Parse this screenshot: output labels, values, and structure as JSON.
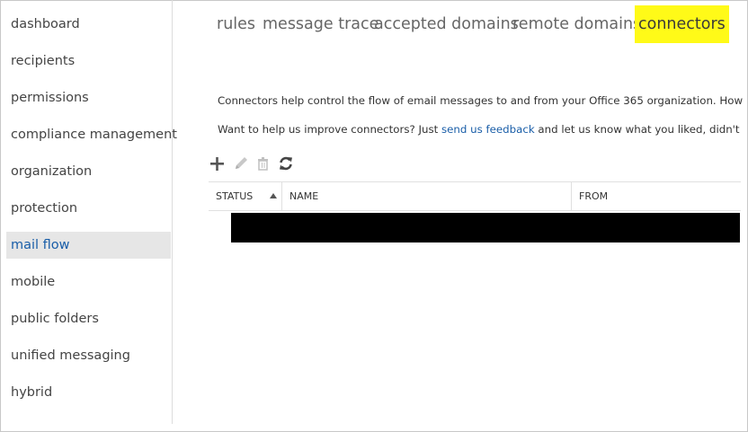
{
  "sidebar": {
    "items": [
      {
        "label": "dashboard"
      },
      {
        "label": "recipients"
      },
      {
        "label": "permissions"
      },
      {
        "label": "compliance management"
      },
      {
        "label": "organization"
      },
      {
        "label": "protection"
      },
      {
        "label": "mail flow",
        "selected": true
      },
      {
        "label": "mobile"
      },
      {
        "label": "public folders"
      },
      {
        "label": "unified messaging"
      },
      {
        "label": "hybrid"
      }
    ]
  },
  "tabs": [
    {
      "label": "rules"
    },
    {
      "label": "message trace"
    },
    {
      "label": "accepted domains"
    },
    {
      "label": "remote domains"
    },
    {
      "label": "connectors",
      "selected": true
    }
  ],
  "description": {
    "line1": "Connectors help control the flow of email messages to and from your Office 365 organization. However, becau",
    "line2_prefix": "Want to help us improve connectors? Just ",
    "line2_link": "send us feedback",
    "line2_suffix": " and let us know what you liked, didn't like, or wha"
  },
  "toolbar": {
    "icons": [
      "add-icon",
      "edit-icon",
      "delete-icon",
      "refresh-icon"
    ]
  },
  "grid": {
    "columns": [
      "STATUS",
      "NAME",
      "FROM"
    ],
    "sort": "ascending"
  },
  "colors": {
    "selected_tab_highlight": "#fffa18",
    "selected_nav_bg": "#e6e6e6",
    "link": "#1a5ea8"
  }
}
